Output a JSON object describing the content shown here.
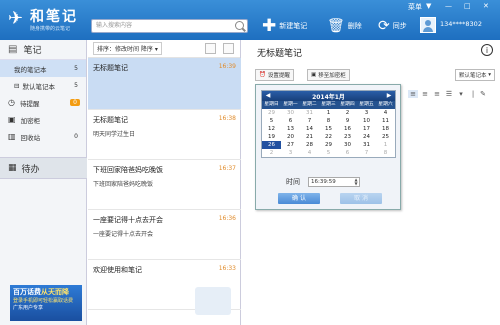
{
  "app": {
    "brand": "和笔记",
    "brand_sub": "随身携带的云笔记",
    "menu": "菜单",
    "window_controls": [
      "▼",
      "—",
      "□",
      "✕"
    ]
  },
  "toolbar": {
    "search_placeholder": "输入搜索内容",
    "new_note": "新建笔记",
    "delete": "删除",
    "sync": "同步",
    "user": "134****8302"
  },
  "sidebar": {
    "header": "笔记",
    "items": [
      {
        "label": "我的笔记本",
        "count": "5",
        "selected": true
      },
      {
        "label": "默认笔记本",
        "count": "5",
        "selected": false
      },
      {
        "label": "待提醒",
        "count": "0",
        "selected": false
      },
      {
        "label": "加密柜",
        "count": "",
        "selected": false
      },
      {
        "label": "回收站",
        "count": "0",
        "selected": false
      }
    ],
    "todo": "待办",
    "ad": {
      "line1": "百万话费",
      "line1b": "从天而降",
      "line2": "登录手机即可轻松赢取话费",
      "line3": "广东用户专享"
    }
  },
  "list": {
    "sort_label": "排序：修改时间  降序",
    "notes": [
      {
        "title": "无标题笔记",
        "date": "16:39",
        "summary": "",
        "selected": true
      },
      {
        "title": "无标题笔记",
        "date": "16:38",
        "summary": "明天同学过生日",
        "selected": false
      },
      {
        "title": "下班回家陪爸妈吃晚饭",
        "date": "16:37",
        "summary": "下班回家陪爸妈吃晚饭",
        "selected": false
      },
      {
        "title": "一座要记得十点去开会",
        "date": "16:36",
        "summary": "一座要记得十点去开会",
        "selected": false
      },
      {
        "title": "欢迎使用和笔记",
        "date": "16:33",
        "summary": "",
        "selected": false
      }
    ]
  },
  "editor": {
    "title": "无标题笔记",
    "remind_button": "设置提醒",
    "encrypt_button": "移至加密柜",
    "notebook_select": "默认笔记本"
  },
  "calendar": {
    "month_label": "2014年1月",
    "weekdays": [
      "星期日",
      "星期一",
      "星期二",
      "星期三",
      "星期四",
      "星期五",
      "星期六"
    ],
    "rows": [
      [
        {
          "d": "29",
          "o": 1
        },
        {
          "d": "30",
          "o": 1
        },
        {
          "d": "31",
          "o": 1
        },
        {
          "d": "1"
        },
        {
          "d": "2"
        },
        {
          "d": "3"
        },
        {
          "d": "4"
        }
      ],
      [
        {
          "d": "5"
        },
        {
          "d": "6"
        },
        {
          "d": "7"
        },
        {
          "d": "8"
        },
        {
          "d": "9"
        },
        {
          "d": "10"
        },
        {
          "d": "11"
        }
      ],
      [
        {
          "d": "12"
        },
        {
          "d": "13"
        },
        {
          "d": "14"
        },
        {
          "d": "15"
        },
        {
          "d": "16"
        },
        {
          "d": "17"
        },
        {
          "d": "18"
        }
      ],
      [
        {
          "d": "19"
        },
        {
          "d": "20"
        },
        {
          "d": "21"
        },
        {
          "d": "22"
        },
        {
          "d": "23"
        },
        {
          "d": "24"
        },
        {
          "d": "25"
        }
      ],
      [
        {
          "d": "26",
          "c": 1
        },
        {
          "d": "27"
        },
        {
          "d": "28"
        },
        {
          "d": "29"
        },
        {
          "d": "30"
        },
        {
          "d": "31"
        },
        {
          "d": "1",
          "o": 1
        }
      ],
      [
        {
          "d": "2",
          "o": 1
        },
        {
          "d": "3",
          "o": 1
        },
        {
          "d": "4",
          "o": 1
        },
        {
          "d": "5",
          "o": 1
        },
        {
          "d": "6",
          "o": 1
        },
        {
          "d": "7",
          "o": 1
        },
        {
          "d": "8",
          "o": 1
        }
      ]
    ],
    "time_label": "时间",
    "time_value": "16:39:59",
    "confirm": "确 认",
    "cancel": "取 消"
  },
  "colors": {
    "accent": "#1e6fc0",
    "selection": "#c9dcf3",
    "date": "#e08b2a",
    "badge": "#f39c12"
  }
}
